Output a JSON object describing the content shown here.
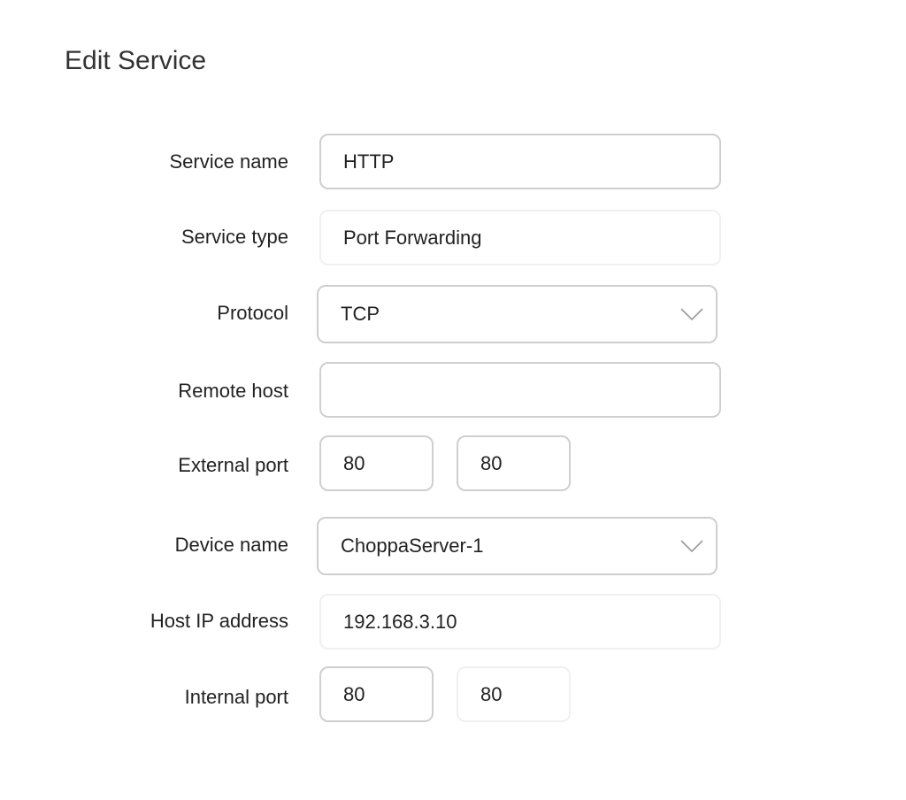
{
  "page": {
    "title": "Edit Service"
  },
  "form": {
    "service_name": {
      "label": "Service name",
      "value": "HTTP"
    },
    "service_type": {
      "label": "Service type",
      "value": "Port Forwarding"
    },
    "protocol": {
      "label": "Protocol",
      "value": "TCP",
      "icon": "chevron-down-icon"
    },
    "remote_host": {
      "label": "Remote host",
      "value": ""
    },
    "external_port": {
      "label": "External port",
      "start": "80",
      "end": "80"
    },
    "device_name": {
      "label": "Device name",
      "value": "ChoppaServer-1",
      "icon": "chevron-down-icon"
    },
    "host_ip": {
      "label": "Host IP address",
      "value": "192.168.3.10"
    },
    "internal_port": {
      "label": "Internal port",
      "start": "80",
      "end": "80"
    }
  }
}
